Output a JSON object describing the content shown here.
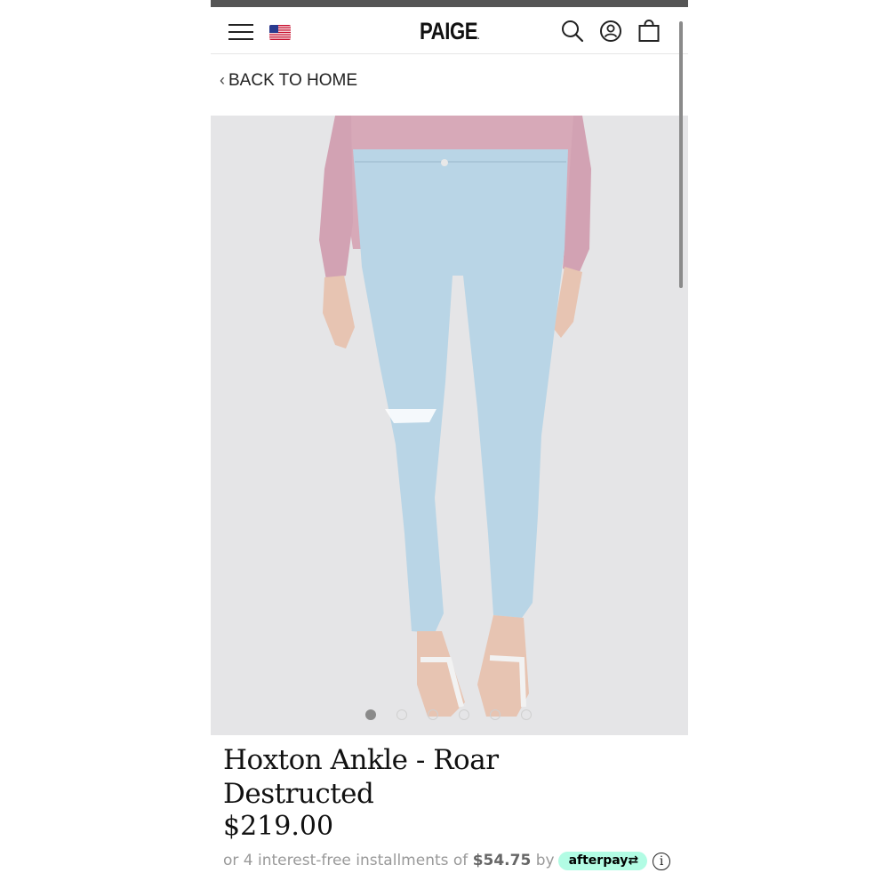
{
  "header": {
    "logo": "PAIGE",
    "logo_mark": ".",
    "icons": [
      "menu-icon",
      "us-flag-icon",
      "search-icon",
      "account-icon",
      "shopping-bag-icon"
    ]
  },
  "nav": {
    "back_label": "BACK TO HOME",
    "back_chevron": "‹"
  },
  "gallery": {
    "slide_count": 6,
    "active_slide": 1
  },
  "product": {
    "title_line1": "Hoxton Ankle - Roar",
    "title_line2": "Destructed",
    "price": "$219.00",
    "installments_prefix": "or 4 interest-free installments of",
    "installment_amount": "$54.75",
    "by": "by",
    "afterpay_label": "afterpay⇄",
    "info_glyph": "i"
  },
  "colors": {
    "afterpay_mint": "#b2fce4",
    "denim": "#b9d5e6",
    "sweater": "#d7a9b8",
    "gallery_bg": "#e5e5e7"
  }
}
